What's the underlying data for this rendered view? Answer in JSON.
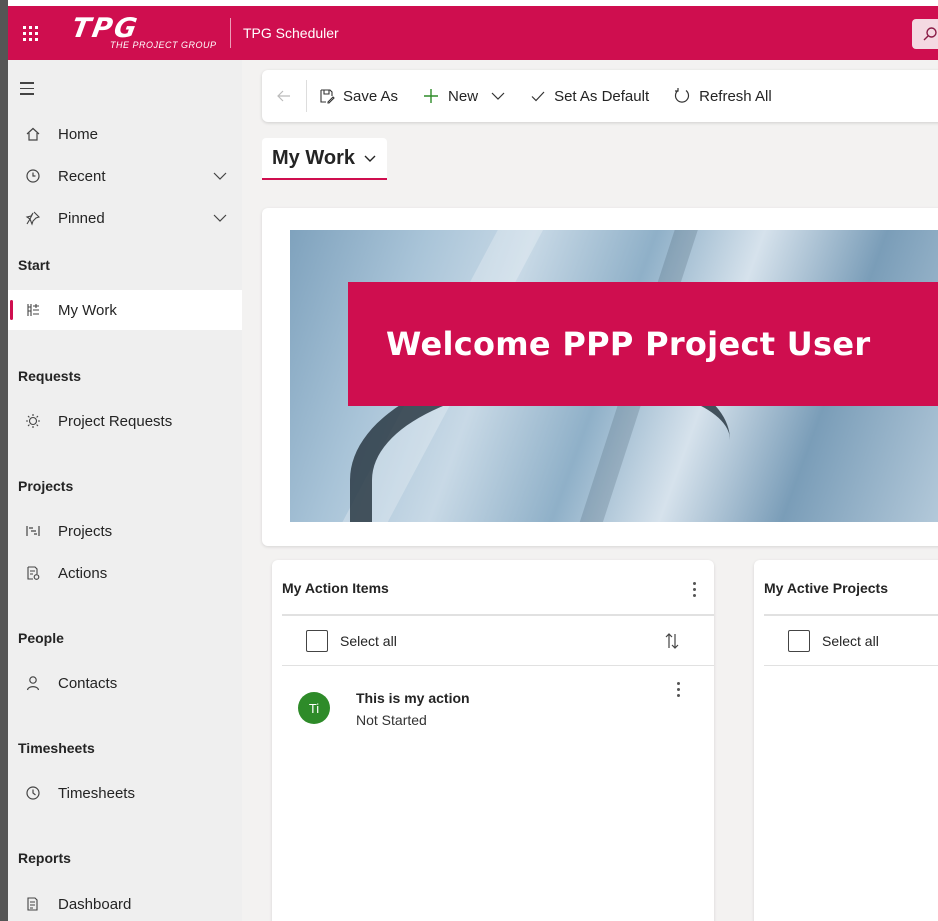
{
  "topbar": {
    "logo_mark": "TPG",
    "logo_sub": "THE PROJECT GROUP",
    "app_title": "TPG Scheduler"
  },
  "sidebar": {
    "items_top": [
      {
        "label": "Home",
        "icon": "home-icon"
      },
      {
        "label": "Recent",
        "icon": "clock-icon"
      },
      {
        "label": "Pinned",
        "icon": "pin-icon"
      }
    ],
    "sections": {
      "start": "Start",
      "requests": "Requests",
      "projects": "Projects",
      "people": "People",
      "timesheets": "Timesheets",
      "reports": "Reports"
    },
    "my_work": "My Work",
    "project_requests": "Project Requests",
    "projects": "Projects",
    "actions": "Actions",
    "contacts": "Contacts",
    "timesheets": "Timesheets",
    "dashboard": "Dashboard"
  },
  "commandbar": {
    "save_as": "Save As",
    "new": "New",
    "set_default": "Set As Default",
    "refresh_all": "Refresh All"
  },
  "view": {
    "title": "My Work"
  },
  "hero": {
    "welcome": "Welcome PPP Project User"
  },
  "action_items": {
    "title": "My Action Items",
    "select_all": "Select all",
    "rows": [
      {
        "initials": "Ti",
        "title": "This is my action",
        "status": "Not Started"
      }
    ]
  },
  "active_projects": {
    "title": "My Active Projects",
    "select_all": "Select all"
  },
  "colors": {
    "brand": "#cf0e4f",
    "avatar_green": "#2e8b29"
  }
}
